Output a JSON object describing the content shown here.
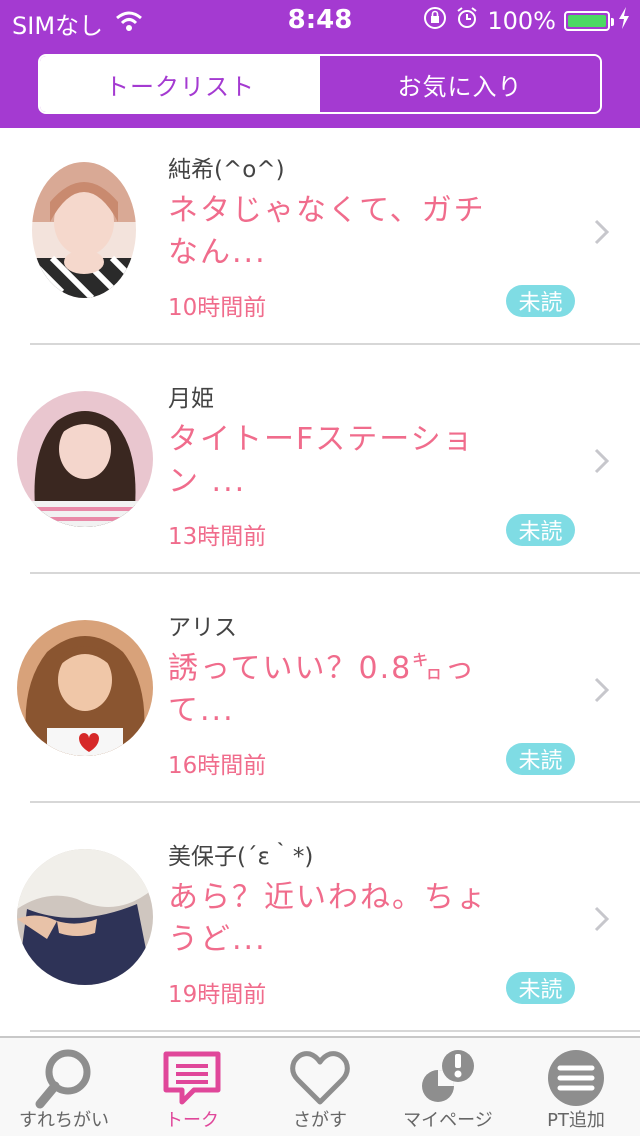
{
  "status_bar": {
    "carrier": "SIMなし",
    "time": "8:48",
    "battery": "100%",
    "battery_level": 1.0
  },
  "segment": {
    "tab_talklist": "トークリスト",
    "tab_favorites": "お気に入り",
    "active": "tab_talklist"
  },
  "conversations": [
    {
      "name": "純希(^o^)",
      "message": "ネタじゃなくて、ガチなん...",
      "time": "10時間前",
      "badge": "未読"
    },
    {
      "name": "月姫",
      "message": "タイトーFステーション ...",
      "time": "13時間前",
      "badge": "未読"
    },
    {
      "name": "アリス",
      "message": "誘っていい？0.8㌔って...",
      "time": "16時間前",
      "badge": "未読"
    },
    {
      "name": "美保子(´ε｀*)",
      "message": "あら？近いわね。ちょうど...",
      "time": "19時間前",
      "badge": "未読"
    }
  ],
  "tabbar": {
    "items": [
      {
        "label": "すれちがい",
        "icon": "search-icon"
      },
      {
        "label": "トーク",
        "icon": "chat-icon"
      },
      {
        "label": "さがす",
        "icon": "heart-icon"
      },
      {
        "label": "マイページ",
        "icon": "profile-icon"
      },
      {
        "label": "PT追加",
        "icon": "menu-icon"
      }
    ],
    "active_index": 1
  },
  "colors": {
    "header": "#a43ad1",
    "accent_pink": "#f06c8c",
    "badge": "#7fdce4",
    "tab_active": "#e0479a"
  }
}
